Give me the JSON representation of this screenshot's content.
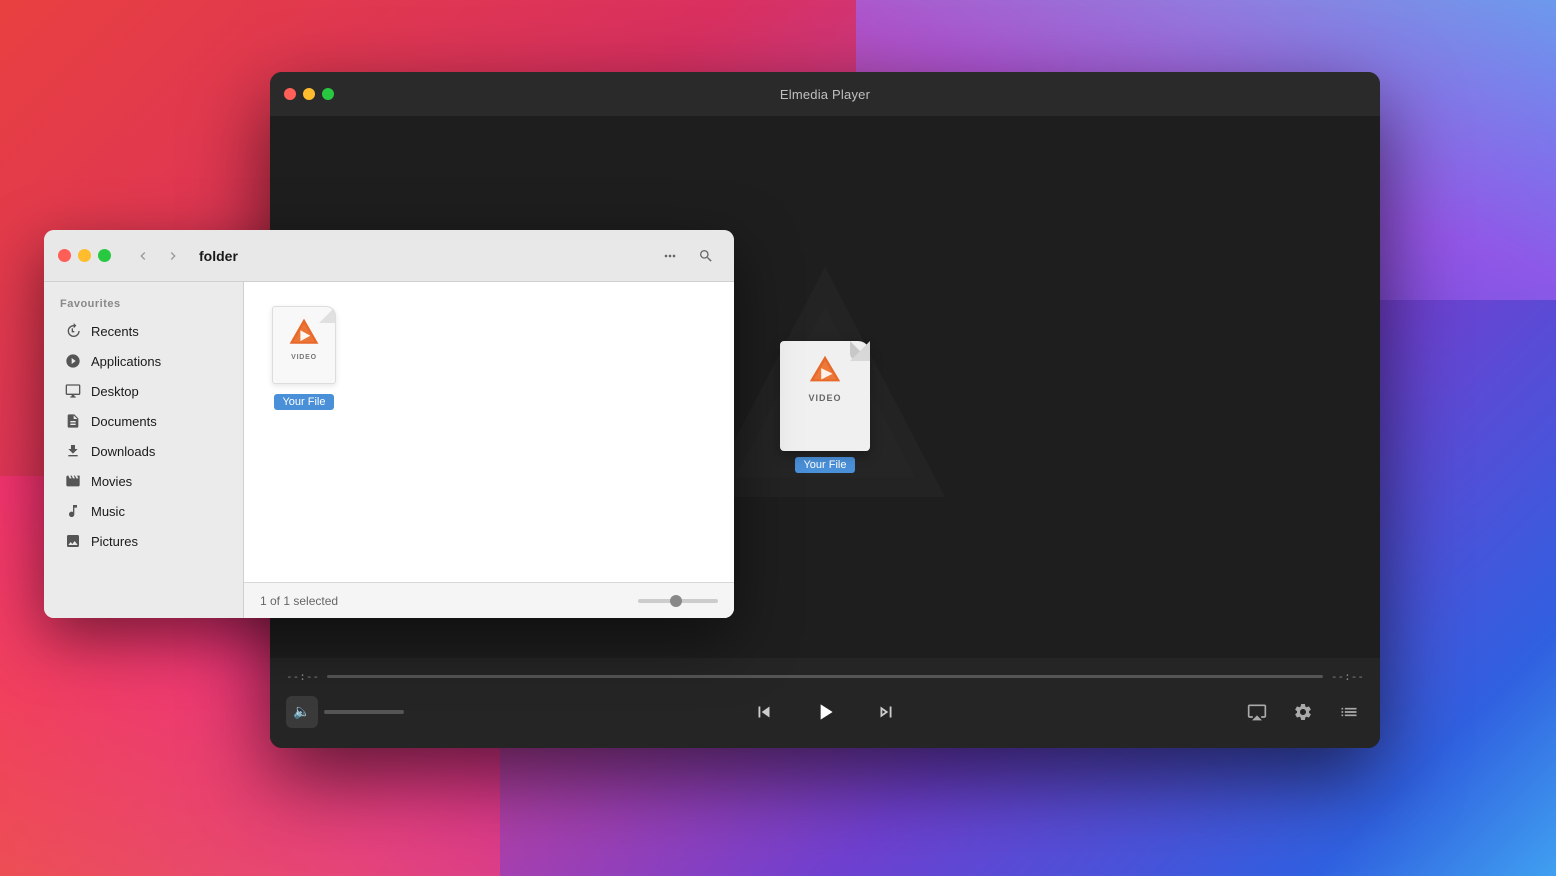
{
  "background": {
    "colors": [
      "#e84040",
      "#d93060",
      "#c040a0",
      "#7040d0",
      "#3060e0",
      "#40a0f0"
    ]
  },
  "player": {
    "title": "Elmedia Player",
    "traffic_lights": {
      "close": "close",
      "minimize": "minimize",
      "maximize": "maximize"
    },
    "time_start": "--:--",
    "time_end": "--:--",
    "file_name": "Your File",
    "file_type": "VIDEO",
    "controls": {
      "volume_icon": "🔈",
      "prev_label": "⏮",
      "play_label": "▶",
      "next_label": "⏭",
      "airplay_icon": "airplay",
      "settings_icon": "settings",
      "playlist_icon": "playlist"
    }
  },
  "finder": {
    "title": "folder",
    "traffic_lights": {
      "close": "close",
      "minimize": "minimize",
      "maximize": "maximize"
    },
    "sidebar": {
      "section_label": "Favourites",
      "items": [
        {
          "id": "recents",
          "label": "Recents",
          "icon": "🕐"
        },
        {
          "id": "applications",
          "label": "Applications",
          "icon": "🚀"
        },
        {
          "id": "desktop",
          "label": "Desktop",
          "icon": "🖥"
        },
        {
          "id": "documents",
          "label": "Documents",
          "icon": "📄"
        },
        {
          "id": "downloads",
          "label": "Downloads",
          "icon": "⬇"
        },
        {
          "id": "movies",
          "label": "Movies",
          "icon": "🎬"
        },
        {
          "id": "music",
          "label": "Music",
          "icon": "🎵"
        },
        {
          "id": "pictures",
          "label": "Pictures",
          "icon": "🖼"
        }
      ]
    },
    "file": {
      "name": "Your File",
      "type": "VIDEO"
    },
    "status": {
      "text": "1 of 1 selected"
    }
  }
}
